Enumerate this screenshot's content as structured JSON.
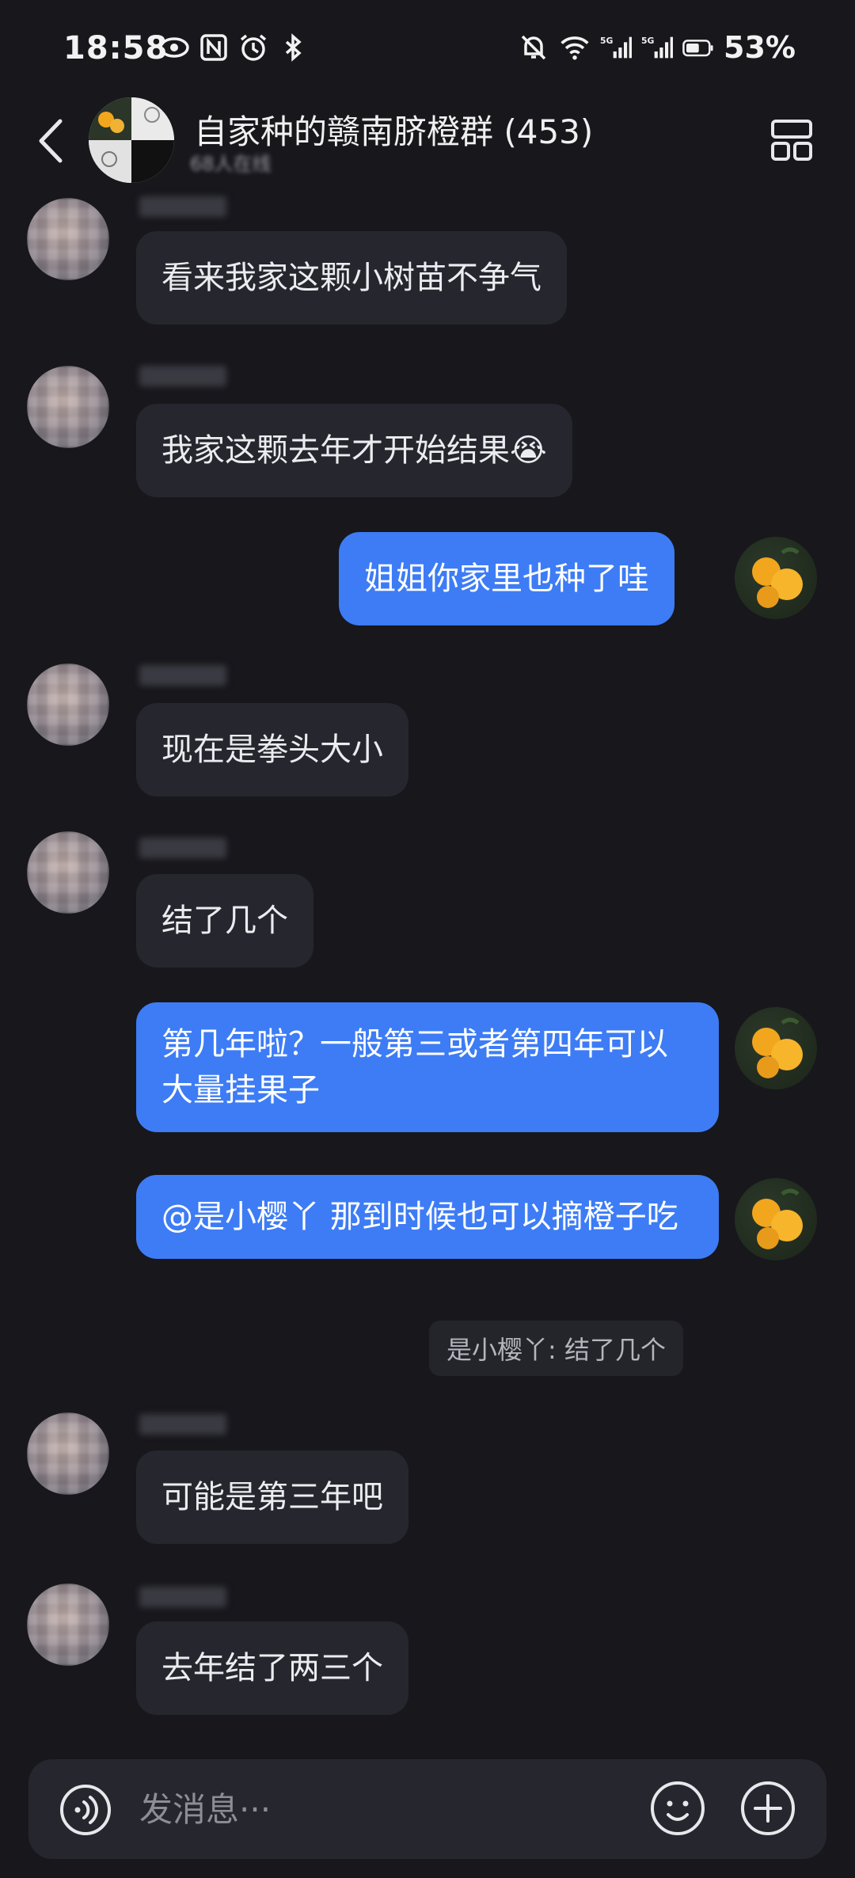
{
  "status_bar": {
    "time": "18:58",
    "battery": "53%",
    "icons_left": [
      "eye-icon",
      "nfc-icon",
      "alarm-icon",
      "bluetooth-icon"
    ],
    "icons_right": [
      "mute-bell-icon",
      "wifi-icon",
      "signal-5g-icon",
      "signal-5g-icon",
      "battery-icon"
    ]
  },
  "header": {
    "title": "自家种的赣南脐橙群 (453)",
    "subtitle": "68人在线"
  },
  "messages": [
    {
      "side": "in",
      "text": "看来我家这颗小树苗不争气"
    },
    {
      "side": "in",
      "text": "我家这颗去年才开始结果",
      "emoji": "😭"
    },
    {
      "side": "out",
      "text": "姐姐你家里也种了哇"
    },
    {
      "side": "in",
      "text": "现在是拳头大小"
    },
    {
      "side": "in",
      "text": "结了几个"
    },
    {
      "side": "out",
      "text": "第几年啦？一般第三或者第四年可以大量挂果子"
    },
    {
      "side": "out",
      "text": "@是小樱丫  那到时候也可以摘橙子吃",
      "quote": "是小樱丫: 结了几个"
    },
    {
      "side": "in",
      "text": "可能是第三年吧"
    },
    {
      "side": "in",
      "text": "去年结了两三个"
    }
  ],
  "input": {
    "placeholder": "发消息···"
  },
  "colors": {
    "background": "#17171c",
    "bubble_in": "#26262e",
    "bubble_out": "#3d7cf5"
  }
}
